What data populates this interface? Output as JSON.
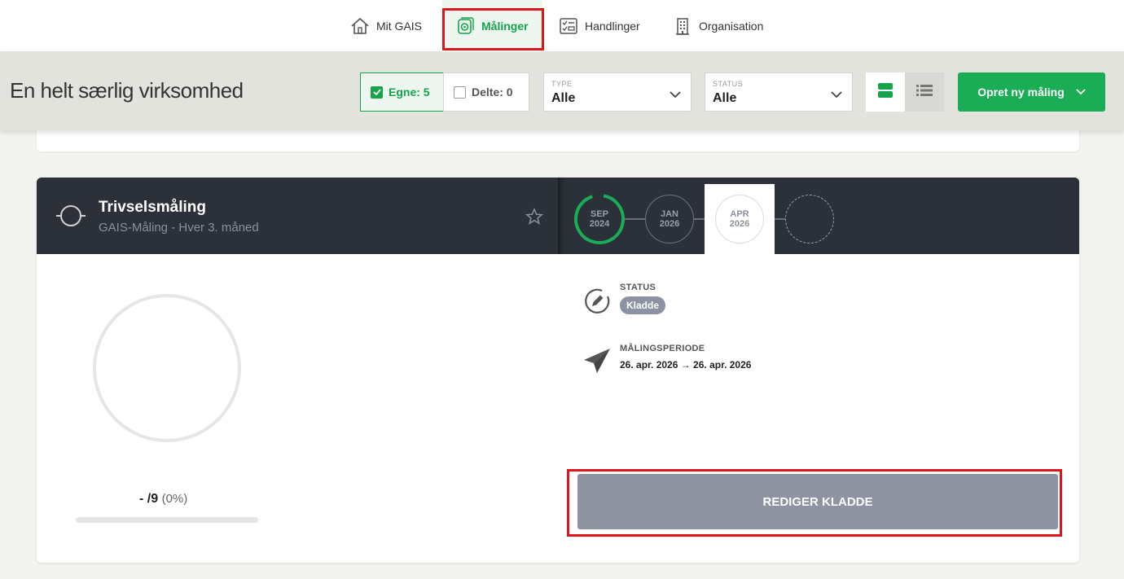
{
  "nav": {
    "items": [
      {
        "label": "Mit GAIS",
        "icon": "home-icon"
      },
      {
        "label": "Målinger",
        "icon": "measurement-icon"
      },
      {
        "label": "Handlinger",
        "icon": "checklist-icon"
      },
      {
        "label": "Organisation",
        "icon": "building-icon"
      }
    ],
    "active_color": "#17a34a"
  },
  "header": {
    "company": "En helt særlig virksomhed",
    "filter_own": "Egne: 5",
    "filter_shared": "Delte: 0",
    "type_label": "TYPE",
    "type_value": "Alle",
    "status_label": "STATUS",
    "status_value": "Alle",
    "create_label": "Opret ny måling"
  },
  "card": {
    "title": "Trivselsmåling",
    "subtitle": "GAIS-Måling - Hver 3. måned",
    "periods": [
      {
        "month": "SEP",
        "year": "2024",
        "state": "completed"
      },
      {
        "month": "JAN",
        "year": "2026",
        "state": "past"
      },
      {
        "month": "APR",
        "year": "2026",
        "state": "selected"
      },
      {
        "month": "",
        "year": "",
        "state": "future"
      }
    ],
    "status_label": "STATUS",
    "status_value": "Kladde",
    "period_label": "MÅLINGSPERIODE",
    "period_value": "26. apr. 2026 → 26. apr. 2026",
    "score_value": "-",
    "score_total": "/9",
    "score_pct": "(0%)",
    "progress": 0,
    "edit_label": "REDIGER KLADDE"
  },
  "colors": {
    "brand_green": "#1aad55",
    "dark_header": "#2b3039",
    "draft_badge": "#8c92a1",
    "highlight": "#e0141b"
  }
}
